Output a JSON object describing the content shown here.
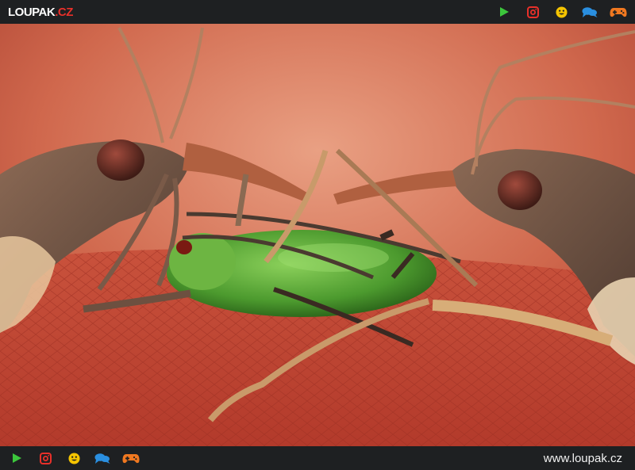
{
  "header": {
    "logo_main": "LOUPAK",
    "logo_tld": ".CZ",
    "icons": [
      "play-icon",
      "instagram-icon",
      "smiley-icon",
      "chat-icon",
      "gamepad-icon"
    ]
  },
  "footer": {
    "icons": [
      "play-icon",
      "instagram-icon",
      "smiley-icon",
      "chat-icon",
      "gamepad-icon"
    ],
    "url": "www.loupak.cz"
  },
  "colors": {
    "bar_bg": "#1e2022",
    "play": "#3cc63c",
    "instagram": "#e8302a",
    "smiley": "#f5c400",
    "chat": "#2a8fe0",
    "gamepad": "#f07820",
    "photo_bg": "#c4553f",
    "aphid": "#5fa83a"
  },
  "photo": {
    "subject": "macro photo of two assassin bugs feeding on a green aphid on a red leaf"
  }
}
